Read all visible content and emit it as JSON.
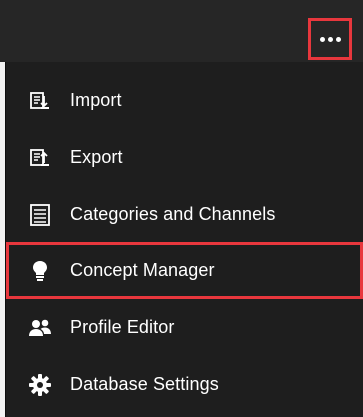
{
  "toolbar": {
    "more_icon": "ellipsis-icon"
  },
  "menu": {
    "items": [
      {
        "label": "Import",
        "icon": "import-icon"
      },
      {
        "label": "Export",
        "icon": "export-icon"
      },
      {
        "label": "Categories and Channels",
        "icon": "document-icon"
      },
      {
        "label": "Concept Manager",
        "icon": "lightbulb-icon"
      },
      {
        "label": "Profile Editor",
        "icon": "users-icon"
      },
      {
        "label": "Database Settings",
        "icon": "gear-icon"
      }
    ]
  },
  "colors": {
    "topbar": "#262626",
    "menu_background": "#1e1e1e",
    "highlight": "#e8373d",
    "text": "#ffffff"
  }
}
